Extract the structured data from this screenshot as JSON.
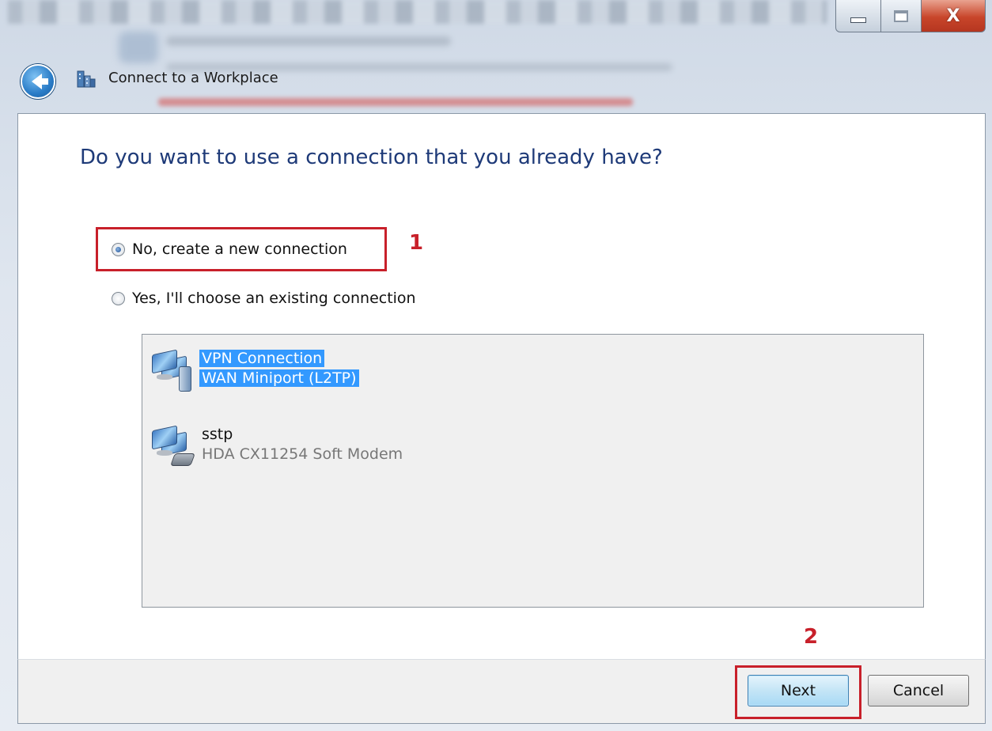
{
  "window": {
    "title": "Connect to a Workplace",
    "caption_buttons": {
      "close_glyph": "X"
    }
  },
  "page": {
    "heading": "Do you want to use a connection that you already have?"
  },
  "options": [
    {
      "label": "No, create a new connection",
      "selected": true
    },
    {
      "label": "Yes, I'll choose an existing connection",
      "selected": false
    }
  ],
  "connections": [
    {
      "name": "VPN Connection",
      "device": "WAN Miniport (L2TP)",
      "selected": true,
      "icon": "vpn-network-icon"
    },
    {
      "name": "sstp",
      "device": "HDA CX11254 Soft Modem",
      "selected": false,
      "icon": "modem-network-icon"
    }
  ],
  "annotations": {
    "step1": "1",
    "step2": "2",
    "color": "#c8202a"
  },
  "buttons": {
    "next": "Next",
    "cancel": "Cancel"
  },
  "colors": {
    "heading": "#1e3a78",
    "selection": "#3399ff"
  }
}
